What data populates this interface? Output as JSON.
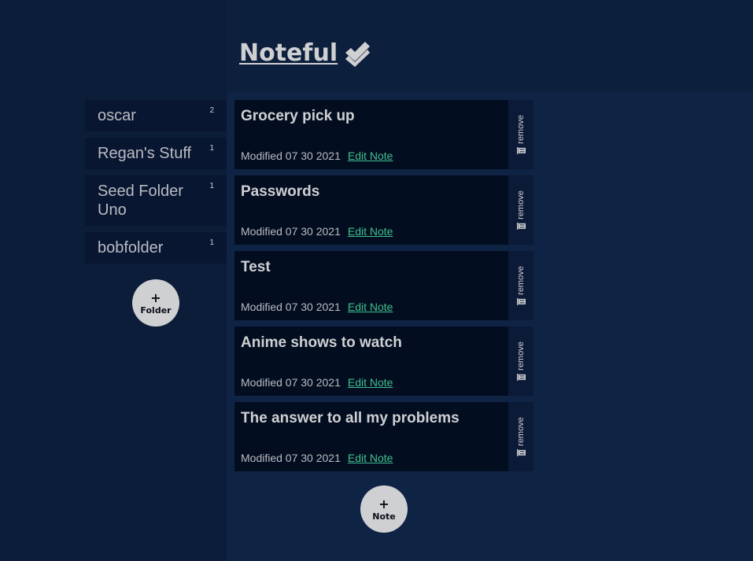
{
  "app": {
    "title": "Noteful",
    "icon": "double-check-icon"
  },
  "folders": [
    {
      "name": "oscar",
      "count": "2"
    },
    {
      "name": "Regan's Stuff",
      "count": "1"
    },
    {
      "name": "Seed Folder Uno",
      "count": "1"
    },
    {
      "name": "bobfolder",
      "count": "1"
    }
  ],
  "add_folder": {
    "plus": "+",
    "label": "Folder"
  },
  "notes": [
    {
      "title": "Grocery pick up",
      "modified": "Modified 07 30 2021",
      "edit": "Edit Note",
      "remove": "remove"
    },
    {
      "title": "Passwords",
      "modified": "Modified 07 30 2021",
      "edit": "Edit Note",
      "remove": "remove"
    },
    {
      "title": "Test",
      "modified": "Modified 07 30 2021",
      "edit": "Edit Note",
      "remove": "remove"
    },
    {
      "title": "Anime shows to watch",
      "modified": "Modified 07 30 2021",
      "edit": "Edit Note",
      "remove": "remove"
    },
    {
      "title": "The answer to all my problems",
      "modified": "Modified 07 30 2021",
      "edit": "Edit Note",
      "remove": "remove"
    }
  ],
  "add_note": {
    "plus": "+",
    "label": "Note"
  },
  "colors": {
    "sidebar": "#0c1d39",
    "main": "#0f2344",
    "card": "#030d20",
    "link": "#3ec18e",
    "text": "#cfd0d2"
  }
}
